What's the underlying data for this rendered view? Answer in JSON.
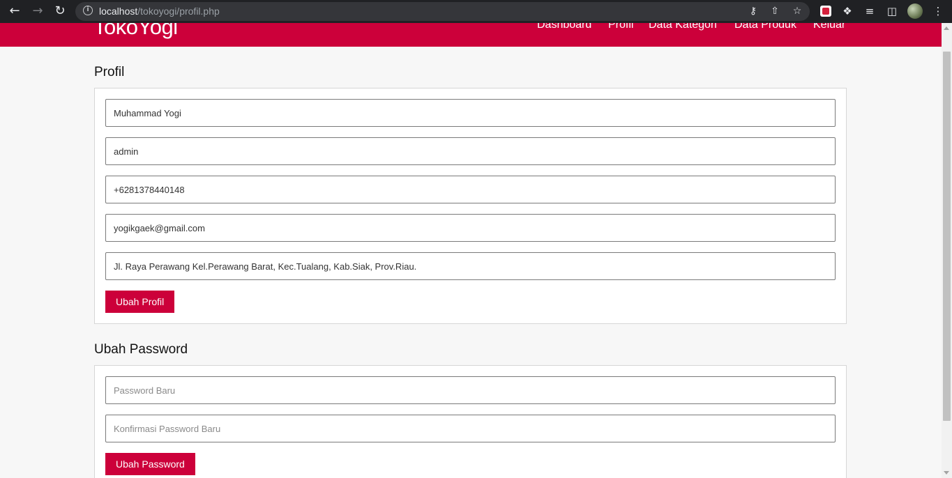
{
  "browser": {
    "url_host": "localhost",
    "url_path": "/tokoyogi/profil.php",
    "back_icon": "arrow-left-icon",
    "forward_icon": "arrow-right-icon",
    "reload_icon": "reload-icon"
  },
  "header": {
    "logo": "TokoYogi",
    "menu": [
      "Dashboard",
      "Profil",
      "Data Kategori",
      "Data Produk",
      "Keluar"
    ],
    "accent_color": "#cc003a"
  },
  "profile": {
    "title": "Profil",
    "name": "Muhammad Yogi",
    "username": "admin",
    "phone": "+6281378440148",
    "email": "yogikgaek@gmail.com",
    "address": "Jl. Raya Perawang Kel.Perawang Barat, Kec.Tualang, Kab.Siak, Prov.Riau.",
    "submit_label": "Ubah Profil"
  },
  "password": {
    "title": "Ubah Password",
    "new_placeholder": "Password Baru",
    "confirm_placeholder": "Konfirmasi Password Baru",
    "submit_label": "Ubah Password"
  }
}
